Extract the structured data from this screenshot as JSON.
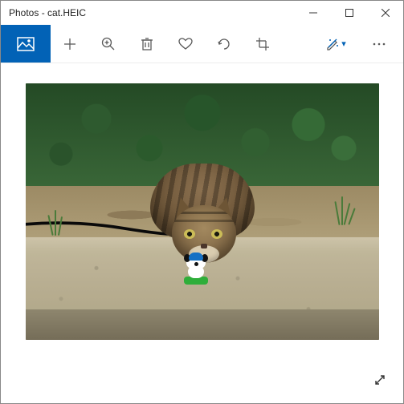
{
  "window": {
    "title": "Photos - cat.HEIC"
  },
  "toolbar": {
    "view_icon": "photo-view-icon",
    "add_icon": "add-icon",
    "zoom_icon": "zoom-icon",
    "delete_icon": "delete-icon",
    "favorite_icon": "heart-icon",
    "rotate_icon": "rotate-icon",
    "crop_icon": "crop-icon",
    "edit_icon": "edit-icon",
    "more_icon": "more-icon"
  },
  "viewer": {
    "image_subject": "tabby cat with toy",
    "fullscreen_icon": "fullscreen-icon"
  }
}
